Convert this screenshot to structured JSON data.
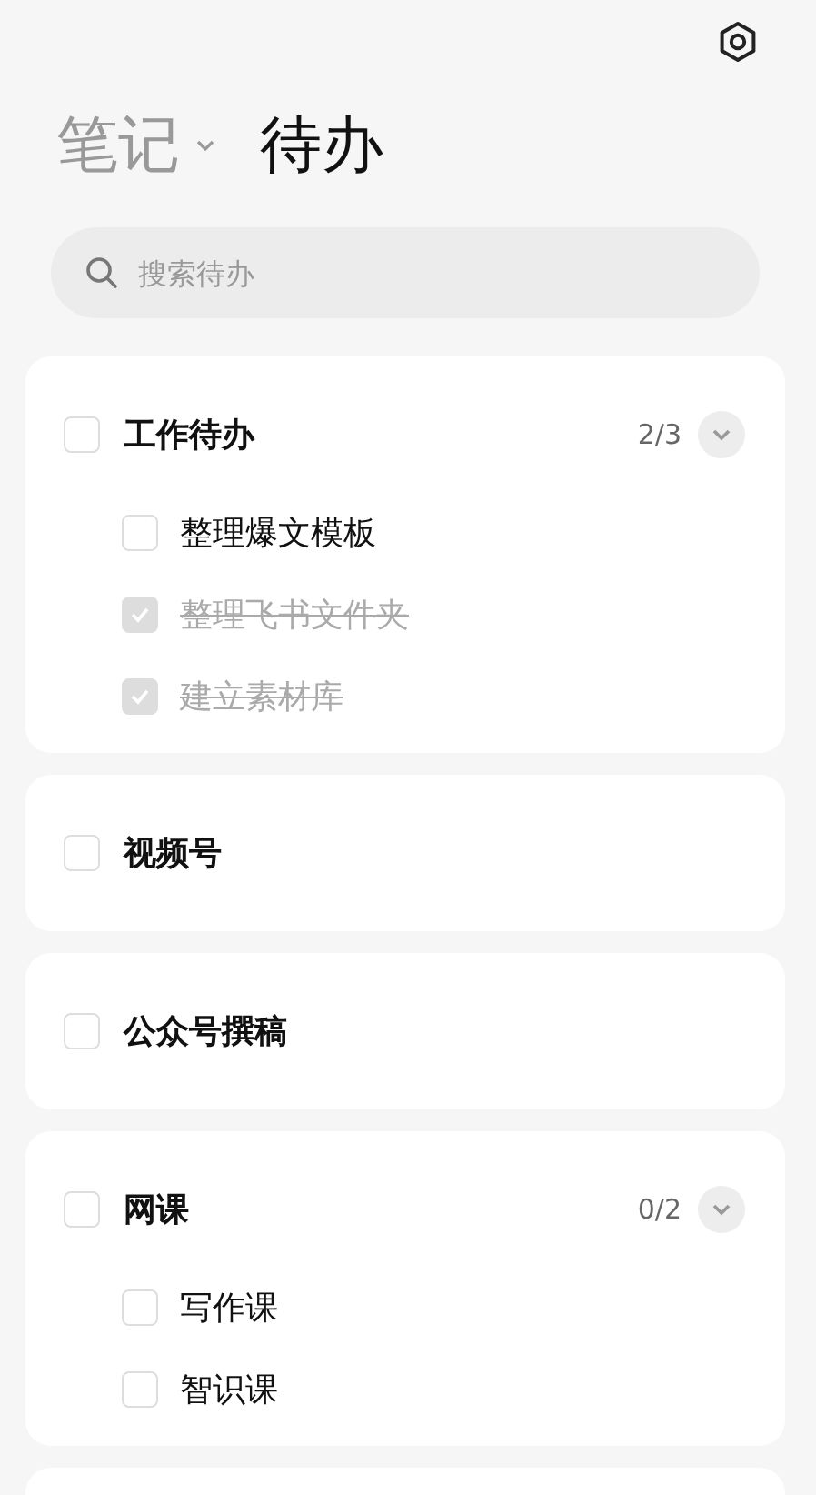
{
  "tabs": [
    {
      "label": "笔记",
      "selected": false,
      "dropdown": true
    },
    {
      "label": "待办",
      "selected": true,
      "dropdown": false
    }
  ],
  "search": {
    "placeholder": "搜索待办"
  },
  "groups": [
    {
      "title": "工作待办",
      "checked": false,
      "count": "2/3",
      "expanded": true,
      "children": [
        {
          "text": "整理爆文模板",
          "checked": false
        },
        {
          "text": "整理飞书文件夹",
          "checked": true
        },
        {
          "text": "建立素材库",
          "checked": true
        }
      ]
    },
    {
      "title": "视频号",
      "checked": false
    },
    {
      "title": "公众号撰稿",
      "checked": false
    },
    {
      "title": "网课",
      "checked": false,
      "count": "0/2",
      "expanded": true,
      "children": [
        {
          "text": "写作课",
          "checked": false
        },
        {
          "text": "智识课",
          "checked": false
        }
      ]
    }
  ]
}
